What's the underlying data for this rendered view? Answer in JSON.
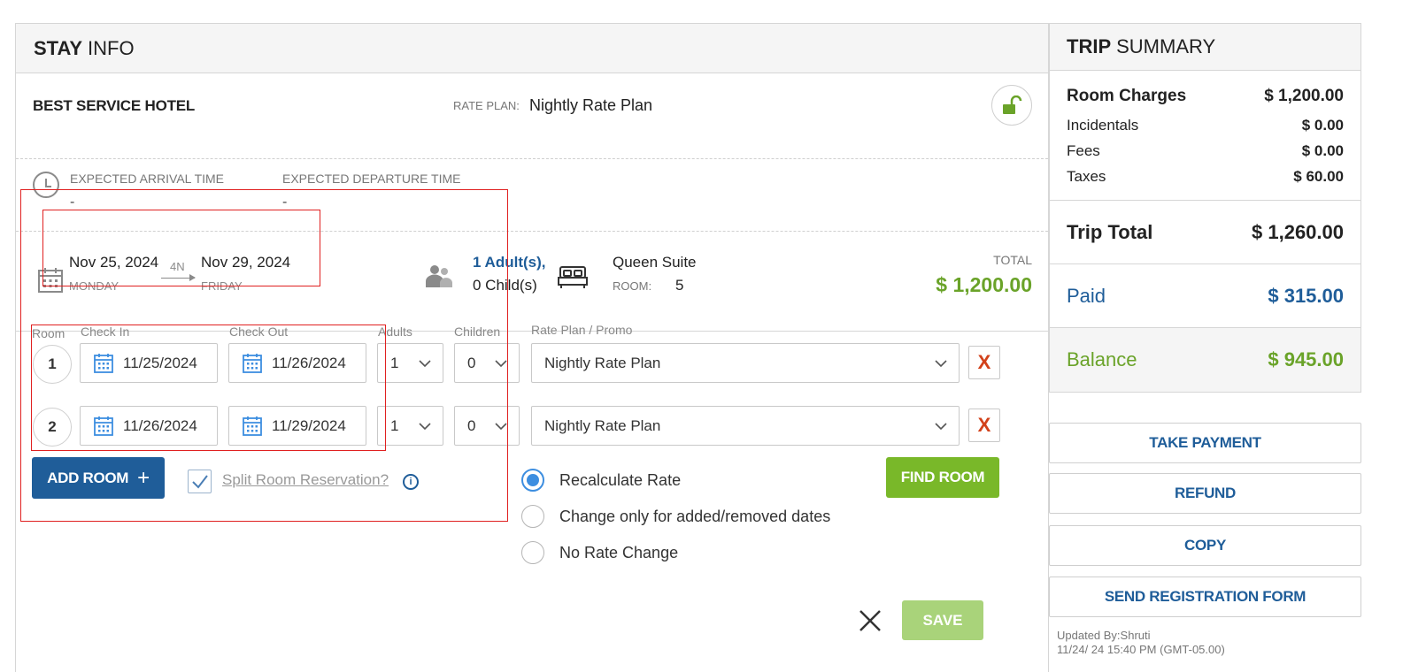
{
  "stay_info": {
    "header_bold": "STAY",
    "header_rest": "INFO",
    "hotel_name": "BEST SERVICE HOTEL",
    "rate_plan_label": "RATE PLAN:",
    "rate_plan_value": "Nightly Rate Plan",
    "arrival_label": "EXPECTED ARRIVAL TIME",
    "arrival_value": "-",
    "departure_label": "EXPECTED DEPARTURE TIME",
    "departure_value": "-",
    "check_in_date": "Nov 25, 2024",
    "check_in_day": "MONDAY",
    "nights": "4N",
    "check_out_date": "Nov 29, 2024",
    "check_out_day": "FRIDAY",
    "adults": "1 Adult(s),",
    "children": "0 Child(s)",
    "room_type": "Queen Suite",
    "room_label": "ROOM:",
    "room_number": "5",
    "total_label": "TOTAL",
    "total_value": "$ 1,200.00"
  },
  "rooms_table": {
    "col_room": "Room",
    "col_check_in": "Check In",
    "col_check_out": "Check Out",
    "col_adults": "Adults",
    "col_children": "Children",
    "col_rate_plan": "Rate Plan / Promo",
    "rows": [
      {
        "room": "1",
        "check_in": "11/25/2024",
        "check_out": "11/26/2024",
        "adults": "1",
        "children": "0",
        "rate_plan": "Nightly Rate Plan"
      },
      {
        "room": "2",
        "check_in": "11/26/2024",
        "check_out": "11/29/2024",
        "adults": "1",
        "children": "0",
        "rate_plan": "Nightly Rate Plan"
      }
    ],
    "remove_label": "X"
  },
  "actions": {
    "add_room": "ADD ROOM",
    "add_plus": "+",
    "split_room": "Split Room Reservation?",
    "split_checked": true,
    "info": "i",
    "find_room": "FIND ROOM",
    "save": "SAVE",
    "rate_options": [
      "Recalculate Rate",
      "Change only for added/removed dates",
      "No Rate Change"
    ],
    "rate_selected": "Recalculate Rate"
  },
  "trip_summary": {
    "header_bold": "TRIP",
    "header_rest": "SUMMARY",
    "room_charges_label": "Room Charges",
    "room_charges": "$ 1,200.00",
    "incidentals_label": "Incidentals",
    "incidentals": "$ 0.00",
    "fees_label": "Fees",
    "fees": "$ 0.00",
    "taxes_label": "Taxes",
    "taxes": "$ 60.00",
    "trip_total_label": "Trip Total",
    "trip_total": "$ 1,260.00",
    "paid_label": "Paid",
    "paid": "$ 315.00",
    "balance_label": "Balance",
    "balance": "$ 945.00",
    "take_payment": "TAKE PAYMENT",
    "refund": "REFUND",
    "copy": "COPY",
    "send_form": "SEND REGISTRATION FORM",
    "updated_by": "Updated By:Shruti",
    "updated_at": "11/24/ 24 15:40 PM (GMT-05.00)"
  },
  "colors": {
    "brand_blue": "#1f5d99",
    "green": "#6aa329",
    "button_green": "#79b829",
    "remove_red": "#d2411a",
    "highlight_red": "#e02020"
  },
  "icons": [
    "clock-icon",
    "calendar-icon",
    "guests-icon",
    "bed-icon",
    "unlock-icon",
    "chevron-down-icon",
    "check-icon",
    "info-icon",
    "close-icon"
  ]
}
